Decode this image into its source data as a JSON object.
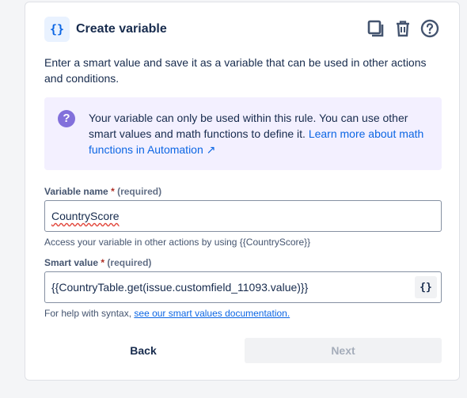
{
  "header": {
    "badge": "{}",
    "title": "Create variable",
    "icons": [
      "copy-icon",
      "trash-icon",
      "help-icon"
    ]
  },
  "description": "Enter a smart value and save it as a variable that can be used in other actions and conditions.",
  "info": {
    "text": "Your variable can only be used within this rule. You can use other smart values and math functions to define it. ",
    "link": "Learn more about math functions in Automation ↗"
  },
  "variable_name": {
    "label": "Variable name",
    "asterisk": "*",
    "required_text": "(required)",
    "value": "CountryScore",
    "help": "Access your variable in other actions by using {{CountryScore}}"
  },
  "smart_value": {
    "label": "Smart value",
    "asterisk": "*",
    "required_text": "(required)",
    "value": "{{CountryTable.get(issue.customfield_11093.value)}}",
    "insert_button": "{}",
    "help_prefix": "For help with syntax, ",
    "help_link": "see our smart values documentation."
  },
  "footer": {
    "back_label": "Back",
    "next_label": "Next"
  }
}
